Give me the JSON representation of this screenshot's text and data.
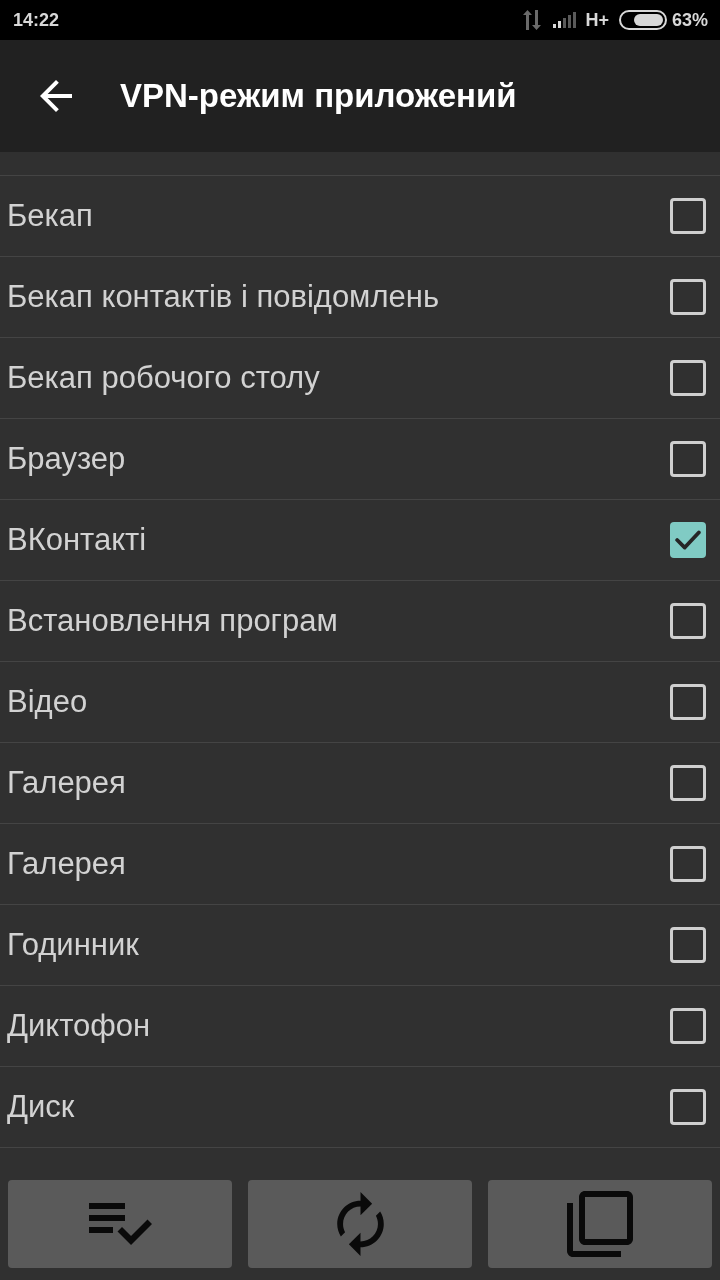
{
  "status_bar": {
    "time": "14:22",
    "network": "H+",
    "battery": "63%"
  },
  "toolbar": {
    "title": "VPN-режим приложений"
  },
  "apps": [
    {
      "name": "Бекап",
      "checked": false
    },
    {
      "name": "Бекап контактів і повідомлень",
      "checked": false
    },
    {
      "name": "Бекап робочого столу",
      "checked": false
    },
    {
      "name": "Браузер",
      "checked": false
    },
    {
      "name": "ВКонтакті",
      "checked": true
    },
    {
      "name": "Встановлення програм",
      "checked": false
    },
    {
      "name": "Відео",
      "checked": false
    },
    {
      "name": "Галерея",
      "checked": false
    },
    {
      "name": "Галерея",
      "checked": false
    },
    {
      "name": "Годинник",
      "checked": false
    },
    {
      "name": "Диктофон",
      "checked": false
    },
    {
      "name": "Диск",
      "checked": false
    }
  ],
  "actions": [
    {
      "kind": "select_all"
    },
    {
      "kind": "sync"
    },
    {
      "kind": "copy"
    }
  ]
}
